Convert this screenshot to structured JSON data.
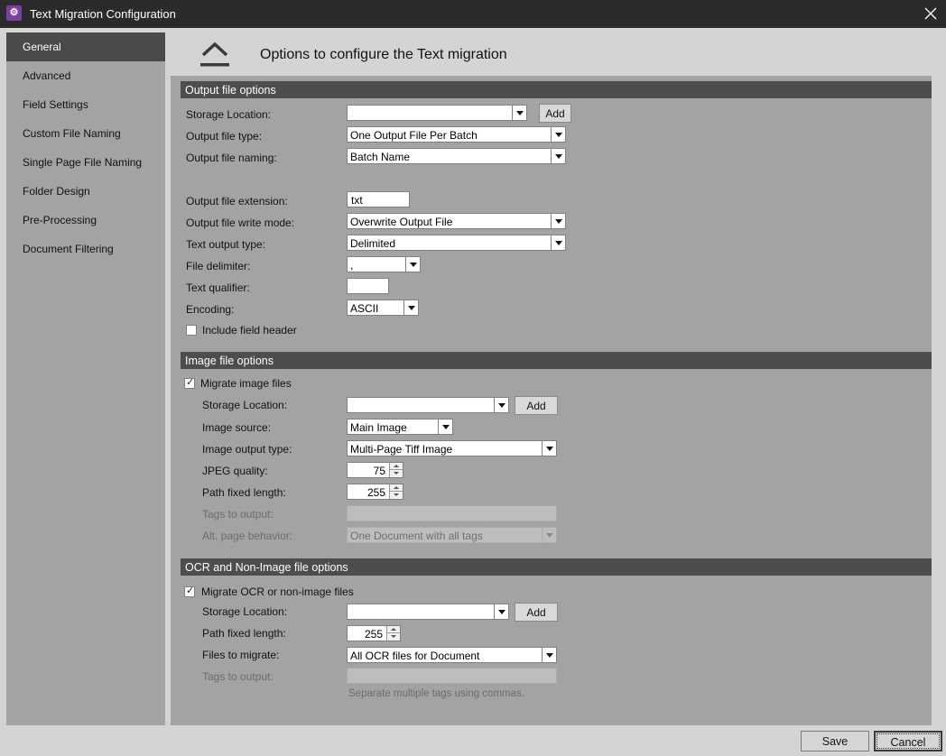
{
  "window": {
    "title": "Text Migration Configuration",
    "app_icon_glyph": "⚙",
    "close_icon": "close-icon"
  },
  "sidebar": {
    "items": [
      {
        "label": "General",
        "active": true
      },
      {
        "label": "Advanced"
      },
      {
        "label": "Field Settings"
      },
      {
        "label": "Custom File Naming"
      },
      {
        "label": "Single Page File Naming"
      },
      {
        "label": "Folder Design"
      },
      {
        "label": "Pre-Processing"
      },
      {
        "label": "Document Filtering"
      }
    ]
  },
  "header": {
    "title": "Options to configure the Text migration",
    "icon": "export-icon"
  },
  "output": {
    "section_title": "Output file options",
    "storage_location_label": "Storage Location:",
    "storage_location_value": "",
    "add_label": "Add",
    "file_type_label": "Output file type:",
    "file_type_value": "One Output File Per Batch",
    "file_naming_label": "Output file naming:",
    "file_naming_value": "Batch Name",
    "extension_label": "Output file extension:",
    "extension_value": "txt",
    "write_mode_label": "Output file write mode:",
    "write_mode_value": "Overwrite Output File",
    "text_output_type_label": "Text output type:",
    "text_output_type_value": "Delimited",
    "delimiter_label": "File delimiter:",
    "delimiter_value": ",",
    "qualifier_label": "Text qualifier:",
    "qualifier_value": "",
    "encoding_label": "Encoding:",
    "encoding_value": "ASCII",
    "include_header_label": "Include field header",
    "include_header_checked": false
  },
  "image": {
    "section_title": "Image file options",
    "migrate_label": "Migrate image files",
    "migrate_checked": true,
    "storage_location_label": "Storage Location:",
    "storage_location_value": "",
    "add_label": "Add",
    "source_label": "Image source:",
    "source_value": "Main Image",
    "output_type_label": "Image output type:",
    "output_type_value": "Multi-Page Tiff Image",
    "jpeg_quality_label": "JPEG quality:",
    "jpeg_quality_value": "75",
    "path_length_label": "Path fixed length:",
    "path_length_value": "255",
    "tags_label": "Tags to output:",
    "tags_value": "",
    "alt_page_label": "Alt. page behavior:",
    "alt_page_value": "One Document with all tags"
  },
  "ocr": {
    "section_title": "OCR and Non-Image file options",
    "migrate_label": "Migrate OCR or non-image files",
    "migrate_checked": true,
    "storage_location_label": "Storage Location:",
    "storage_location_value": "",
    "add_label": "Add",
    "path_length_label": "Path fixed length:",
    "path_length_value": "255",
    "files_label": "Files to migrate:",
    "files_value": "All OCR files for Document",
    "tags_label": "Tags to output:",
    "tags_value": "",
    "tags_hint": "Separate multiple tags using commas."
  },
  "footer": {
    "save_label": "Save",
    "cancel_label": "Cancel"
  },
  "colors": {
    "titlebar": "#2b2b2b",
    "panel": "#a3a3a3",
    "section_header": "#4d4d4d",
    "active_nav": "#4a4a4a",
    "app_icon": "#7a3fa0"
  }
}
